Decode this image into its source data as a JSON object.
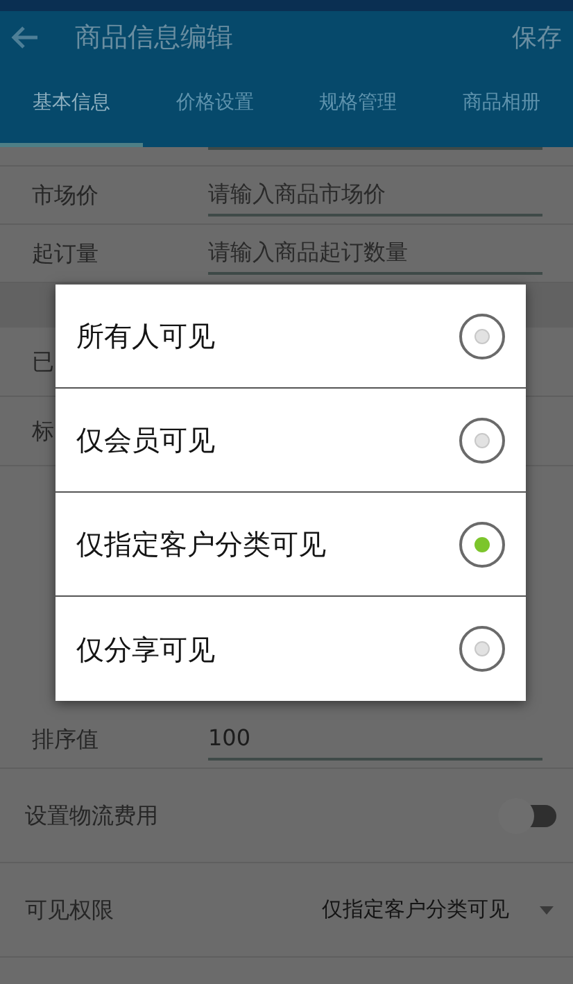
{
  "app_bar": {
    "title": "商品信息编辑",
    "action": "保存"
  },
  "tabs": [
    {
      "label": "基本信息",
      "selected": true
    },
    {
      "label": "价格设置",
      "selected": false
    },
    {
      "label": "规格管理",
      "selected": false
    },
    {
      "label": "商品相册",
      "selected": false
    }
  ],
  "form": [
    {
      "kind": "input",
      "label": "市场价",
      "placeholder": "请输入商品市场价"
    },
    {
      "kind": "input",
      "label": "起订量",
      "placeholder": "请输入商品起订数量"
    },
    {
      "kind": "partial",
      "label": "已"
    },
    {
      "kind": "partial",
      "label": "标"
    },
    {
      "kind": "input",
      "label": "排序值",
      "value": "100"
    },
    {
      "kind": "toggle",
      "label": "设置物流费用",
      "on": false
    },
    {
      "kind": "select",
      "label": "可见权限",
      "value": "仅指定客户分类可见"
    }
  ],
  "dialog": {
    "options": [
      {
        "label": "所有人可见",
        "selected": false
      },
      {
        "label": "仅会员可见",
        "selected": false
      },
      {
        "label": "仅指定客户分类可见",
        "selected": true
      },
      {
        "label": "仅分享可见",
        "selected": false
      }
    ]
  }
}
